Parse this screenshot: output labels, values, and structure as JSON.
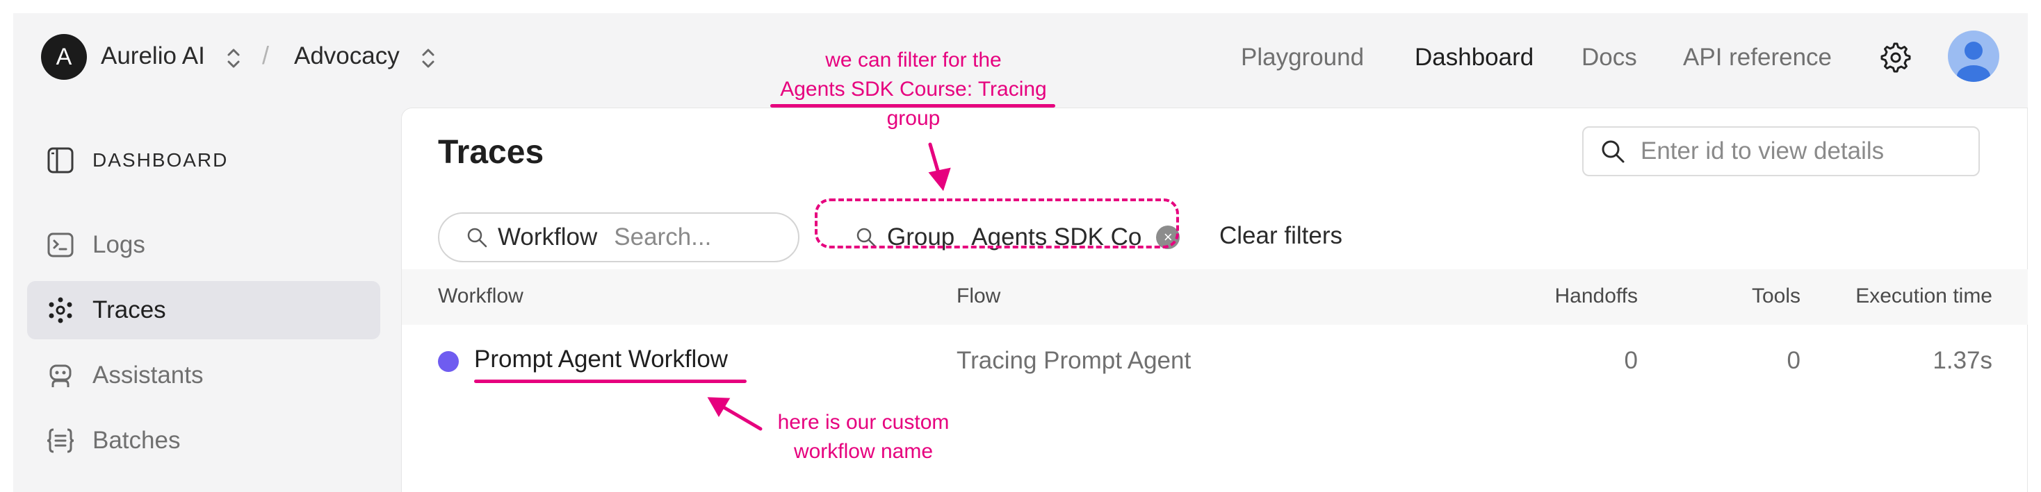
{
  "topbar": {
    "org_initial": "A",
    "org_name": "Aurelio AI",
    "separator": "/",
    "project_name": "Advocacy",
    "nav": [
      {
        "label": "Playground",
        "active": false
      },
      {
        "label": "Dashboard",
        "active": true
      },
      {
        "label": "Docs",
        "active": false
      },
      {
        "label": "API reference",
        "active": false
      }
    ],
    "settings_icon": "gear-icon",
    "user_icon": "user-avatar-icon"
  },
  "sidebar": {
    "heading": "DASHBOARD",
    "items": [
      {
        "label": "Logs",
        "icon": "terminal-icon",
        "active": false
      },
      {
        "label": "Traces",
        "icon": "traces-icon",
        "active": true
      },
      {
        "label": "Assistants",
        "icon": "robot-icon",
        "active": false
      },
      {
        "label": "Batches",
        "icon": "braces-list-icon",
        "active": false
      }
    ]
  },
  "main": {
    "title": "Traces",
    "id_search": {
      "placeholder": "Enter id to view details"
    },
    "filters": {
      "workflow": {
        "label": "Workflow",
        "placeholder": "Search..."
      },
      "group": {
        "label": "Group",
        "value": "Agents SDK Course: Tracing"
      },
      "clear_label": "Clear filters"
    },
    "table": {
      "headers": [
        "Workflow",
        "Flow",
        "Handoffs",
        "Tools",
        "Execution time"
      ],
      "rows": [
        {
          "workflow": "Prompt Agent Workflow",
          "flow": "Tracing Prompt Agent",
          "handoffs": "0",
          "tools": "0",
          "execution_time": "1.37s",
          "dot_color": "#6f5cf0"
        }
      ]
    }
  },
  "annotations": {
    "filter_note": {
      "line1": "we can filter for the",
      "line2": "Agents SDK Course: Tracing",
      "line3": "group"
    },
    "workflow_note": {
      "line1": "here is our custom",
      "line2": "workflow name"
    },
    "color": "#e6007e"
  }
}
